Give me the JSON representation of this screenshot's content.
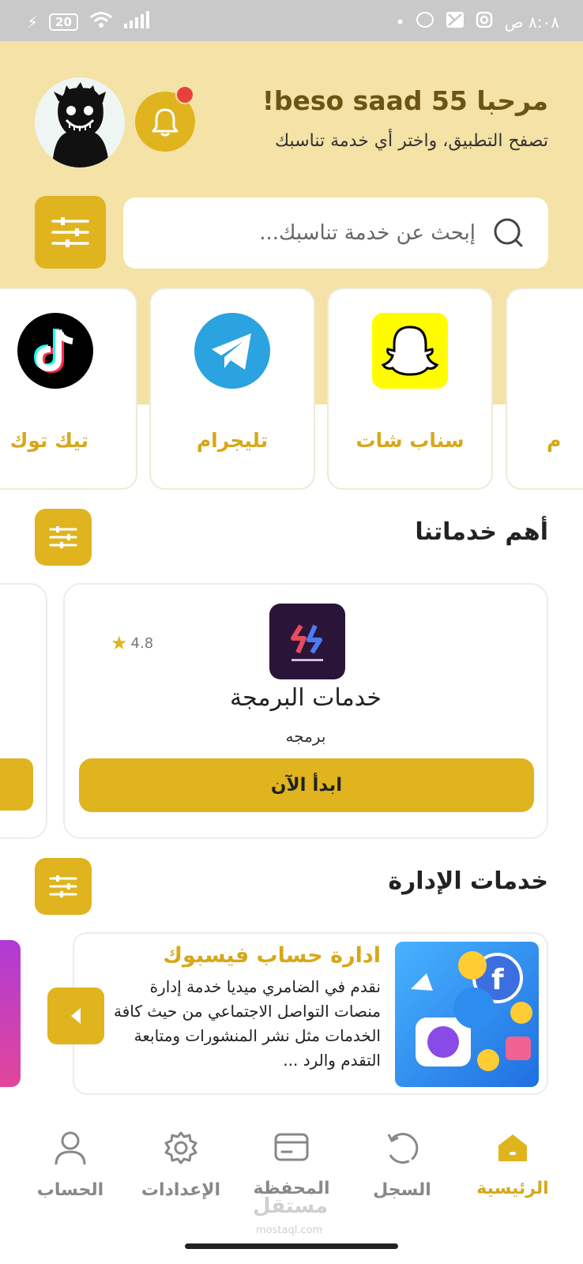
{
  "status_bar": {
    "time": "٨:٠٨ ص",
    "battery": "20"
  },
  "header": {
    "greeting": "مرحبا beso saad 55!",
    "subtitle": "تصفح التطبيق، واختر أي خدمة تناسبك"
  },
  "search": {
    "placeholder": "إبحث عن خدمة تناسبك..."
  },
  "platforms": [
    {
      "label": "سناب شات",
      "icon": "snapchat-icon"
    },
    {
      "label": "تليجرام",
      "icon": "telegram-icon"
    },
    {
      "label": "تيك توك",
      "icon": "tiktok-icon"
    },
    {
      "label": "م",
      "icon": ""
    }
  ],
  "top_services": {
    "title": "أهم خدماتنا",
    "card": {
      "rating": "4.8",
      "name": "خدمات البرمجة",
      "category": "برمجه",
      "button": "ابدأ الآن"
    }
  },
  "management": {
    "title": "خدمات الإدارة",
    "card": {
      "title": "ادارة حساب فيسبوك",
      "description": "نقدم في الضامري ميديا خدمة إدارة منصات التواصل الاجتماعي من حيث كافة الخدمات مثل نشر المنشورات ومتابعة التقدم والرد ..."
    }
  },
  "nav": [
    {
      "label": "الرئيسية",
      "icon": "home-icon",
      "active": true
    },
    {
      "label": "السجل",
      "icon": "history-icon"
    },
    {
      "label": "المحفظة",
      "icon": "wallet-icon"
    },
    {
      "label": "الإعدادات",
      "icon": "settings-icon"
    },
    {
      "label": "الحساب",
      "icon": "account-icon"
    }
  ],
  "watermark": {
    "text": "مستقل",
    "url": "mostaql.com"
  },
  "colors": {
    "accent": "#dfb41f",
    "hero": "#f4e2a6"
  }
}
